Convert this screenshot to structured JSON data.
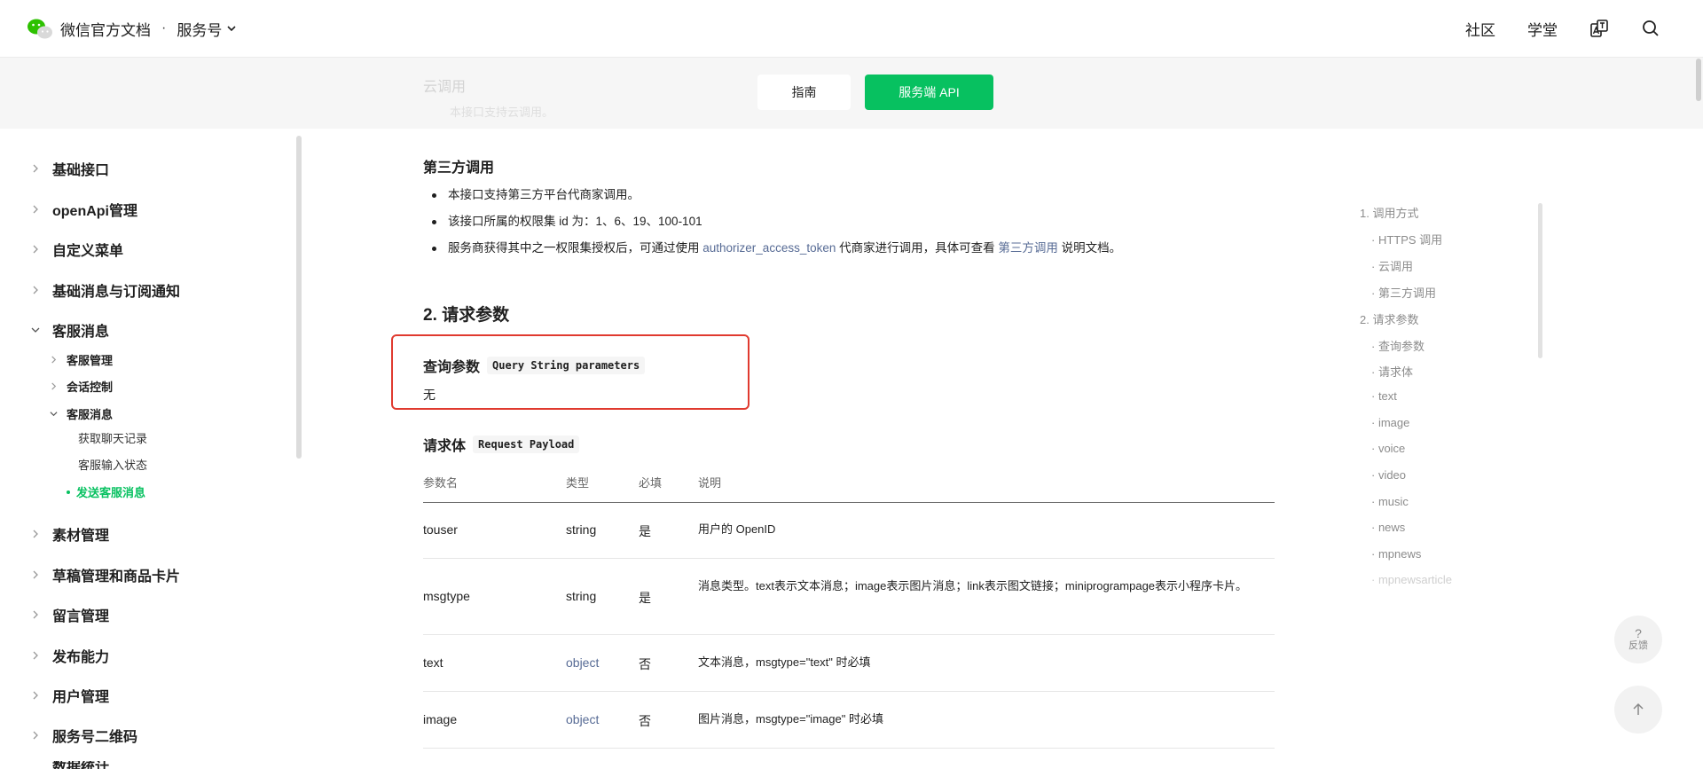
{
  "header": {
    "title": "微信官方文档",
    "separator": "·",
    "product": "服务号",
    "nav": [
      "社区",
      "学堂"
    ],
    "icons": [
      "chevron-down-icon",
      "translate-icon",
      "search-icon"
    ]
  },
  "tabs": {
    "guide": "指南",
    "api": "服务端 API",
    "ghost_heading": "云调用",
    "ghost_line": "本接口支持云调用。"
  },
  "sidebar": {
    "items_top": [
      "基础接口",
      "openApi管理",
      "自定义菜单",
      "基础消息与订阅通知"
    ],
    "kefu": "客服消息",
    "kefu_children": [
      "客服管理",
      "会话控制",
      "客服消息"
    ],
    "kefu_msg_children": [
      "获取聊天记录",
      "客服输入状态"
    ],
    "active": "发送客服消息",
    "items_bottom": [
      "素材管理",
      "草稿管理和商品卡片",
      "留言管理",
      "发布能力",
      "用户管理",
      "服务号二维码",
      "数据统计"
    ]
  },
  "content": {
    "third_party_heading": "第三方调用",
    "bullets": {
      "b1": "本接口支持第三方平台代商家调用。",
      "b2": "该接口所属的权限集 id 为：1、6、19、100-101",
      "b3_pre": "服务商获得其中之一权限集授权后，可通过使用 ",
      "b3_link1": "authorizer_access_token",
      "b3_mid": " 代商家进行调用，具体可查看 ",
      "b3_link2": "第三方调用",
      "b3_post": " 说明文档。"
    },
    "request_params_heading": "2. 请求参数",
    "query": {
      "title": "查询参数",
      "code": "Query String parameters",
      "value": "无"
    },
    "payload": {
      "title": "请求体",
      "code": "Request Payload"
    },
    "table": {
      "headers": [
        "参数名",
        "类型",
        "必填",
        "说明"
      ],
      "rows": [
        {
          "name": "touser",
          "type": "string",
          "required": "是",
          "desc": "用户的 OpenID"
        },
        {
          "name": "msgtype",
          "type": "string",
          "required": "是",
          "desc": "消息类型。text表示文本消息；image表示图片消息；link表示图文链接；miniprogrampage表示小程序卡片。"
        },
        {
          "name": "text",
          "type": "object",
          "required": "否",
          "desc": "文本消息，msgtype=\"text\" 时必填"
        },
        {
          "name": "image",
          "type": "object",
          "required": "否",
          "desc": "图片消息，msgtype=\"image\" 时必填"
        }
      ]
    }
  },
  "toc": {
    "i1": "1. 调用方式",
    "i2": "· HTTPS 调用",
    "i3": "· 云调用",
    "i4": "· 第三方调用",
    "i5": "2. 请求参数",
    "i6": "· 查询参数",
    "i7": "· 请求体",
    "i8": "· text",
    "i9": "· image",
    "i10": "· voice",
    "i11": "· video",
    "i12": "· music",
    "i13": "· news",
    "i14": "· mpnews",
    "i15": "· mpnewsarticle"
  },
  "floating": {
    "feedback_mark": "?",
    "feedback_label": "反馈",
    "top_icon": "arrow-up-icon"
  },
  "colors": {
    "accent": "#07c160",
    "link": "#576b95",
    "highlight": "#e03a2f"
  }
}
